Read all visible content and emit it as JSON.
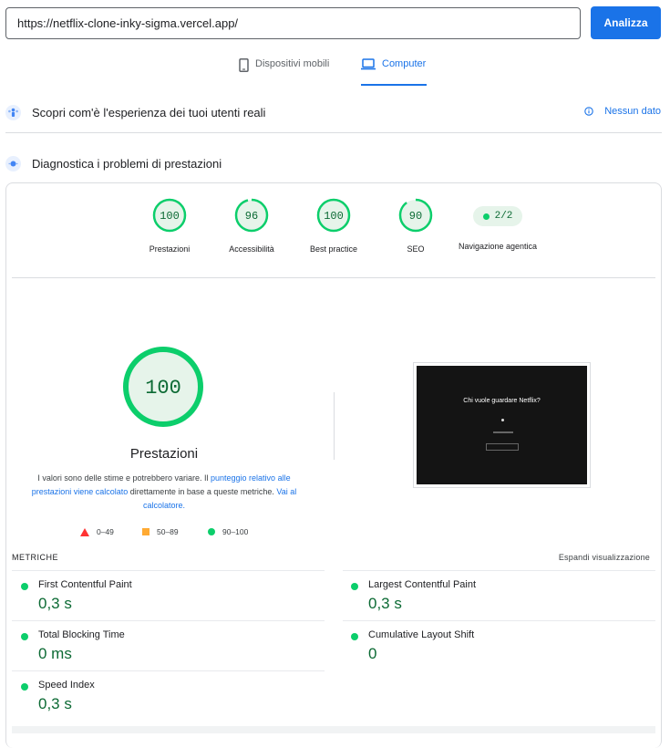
{
  "url_input": {
    "value": "https://netflix-clone-inky-sigma.vercel.app/"
  },
  "analyze_label": "Analizza",
  "tabs": {
    "mobile": "Dispositivi mobili",
    "desktop": "Computer"
  },
  "crux": {
    "title": "Scopri com'è l'esperienza dei tuoi utenti reali",
    "no_data": "Nessun dato"
  },
  "diagnostics": {
    "title": "Diagnostica i problemi di prestazioni"
  },
  "scores": [
    {
      "value": "100",
      "label": "Prestazioni",
      "fraction": 1.0
    },
    {
      "value": "96",
      "label": "Accessibilità",
      "fraction": 0.96
    },
    {
      "value": "100",
      "label": "Best practice",
      "fraction": 1.0
    },
    {
      "value": "90",
      "label": "SEO",
      "fraction": 0.9
    }
  ],
  "agentic": {
    "value": "2/2",
    "label": "Navigazione agentica"
  },
  "performance": {
    "score": "100",
    "title": "Prestazioni",
    "disclaimer_1": "I valori sono delle stime e potrebbero variare. Il ",
    "disclaimer_link_1": "punteggio relativo alle prestazioni viene calcolato",
    "disclaimer_2": " direttamente in base a queste metriche. ",
    "disclaimer_link_2": "Vai al calcolatore.",
    "legend": {
      "poor": "0–49",
      "average": "50–89",
      "good": "90–100"
    }
  },
  "screenshot": {
    "heading": "Chi vuole guardare Netflix?"
  },
  "metrics": {
    "heading": "METRICHE",
    "expand": "Espandi visualizzazione",
    "fcp": {
      "name": "First Contentful Paint",
      "value": "0,3 s"
    },
    "lcp": {
      "name": "Largest Contentful Paint",
      "value": "0,3 s"
    },
    "tbt": {
      "name": "Total Blocking Time",
      "value": "0 ms"
    },
    "cls": {
      "name": "Cumulative Layout Shift",
      "value": "0"
    },
    "si": {
      "name": "Speed Index",
      "value": "0,3 s"
    }
  },
  "colors": {
    "accent": "#1a73e8",
    "pass": "#0cce6b",
    "pass_text": "#0c6a34",
    "pass_bg": "#e6f4ea",
    "fail": "#ff3333",
    "warn": "#ffaa33"
  },
  "icons": {
    "mobile": "smartphone-icon",
    "desktop": "laptop-icon",
    "crux": "users-icon",
    "diagnostics": "lighthouse-icon",
    "info": "info-icon"
  }
}
